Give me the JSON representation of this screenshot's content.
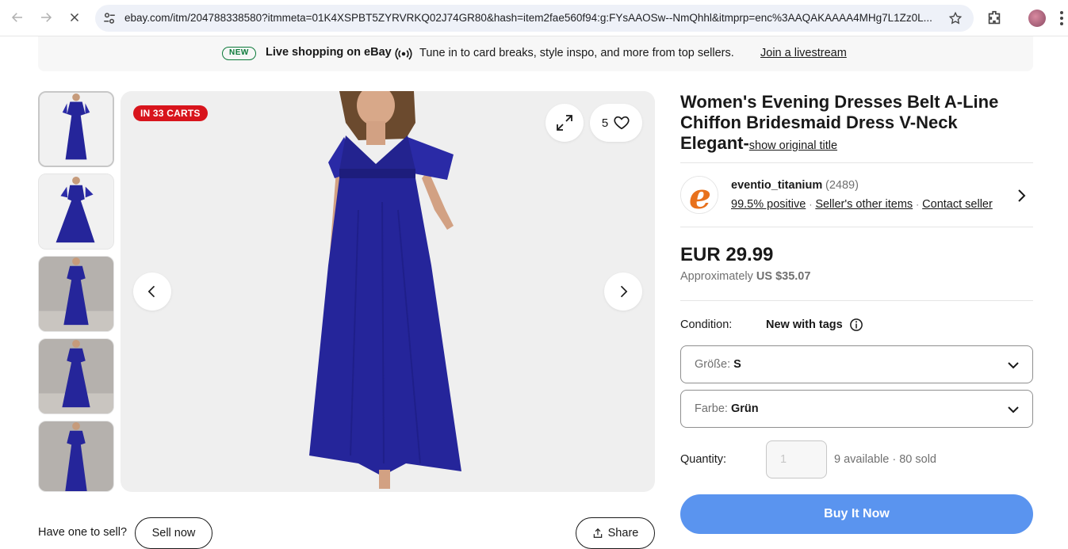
{
  "browser": {
    "url": "ebay.com/itm/204788338580?itmmeta=01K4XSPBT5ZYRVRKQ02J74GR80&hash=item2fae560f94:g:FYsAAOSw--NmQhhl&itmprp=enc%3AAQAKAAAA4MHg7L1Zz0L...",
    "icons": [
      "back-icon",
      "forward-icon",
      "stop-icon",
      "site-settings-icon",
      "bookmark-star-icon",
      "extensions-icon",
      "profile-avatar",
      "menu-kebab-icon"
    ]
  },
  "banner": {
    "badge": "NEW",
    "title": "Live shopping on eBay",
    "text": "Tune in to card breaks, style inspo, and more from top sellers.",
    "link": "Join a livestream"
  },
  "gallery": {
    "carts_badge": "IN 33 CARTS",
    "watch_count": "5",
    "thumbnail_count": 5,
    "dress_color": "#25259a"
  },
  "below_gallery": {
    "have_one": "Have one to sell?",
    "sell_now": "Sell now",
    "share": "Share"
  },
  "listing": {
    "title": "Women's Evening Dresses Belt A-Line Chiffon Bridesmaid Dress V-Neck Elegant-",
    "show_original": "show original title"
  },
  "seller": {
    "name": "eventio_titanium",
    "feedback_count": "(2489)",
    "positive": "99.5% positive",
    "other_items": "Seller's other items",
    "contact": "Contact seller",
    "logo_letter": "e",
    "logo_color": "#e8711c"
  },
  "pricing": {
    "price": "EUR 29.99",
    "approx_prefix": "Approximately",
    "approx_value": "US $35.07"
  },
  "condition": {
    "label": "Condition:",
    "value": "New with tags"
  },
  "options": {
    "size_label": "Größe:",
    "size_value": "S",
    "color_label": "Farbe:",
    "color_value": "Grün"
  },
  "quantity": {
    "label": "Quantity:",
    "value": "1",
    "available": "9 available",
    "sold": "80 sold"
  },
  "buy_now": "Buy It Now",
  "colors": {
    "accent_blue": "#5a94ef",
    "badge_red": "#d8141c",
    "new_green": "#0c7a3a"
  }
}
